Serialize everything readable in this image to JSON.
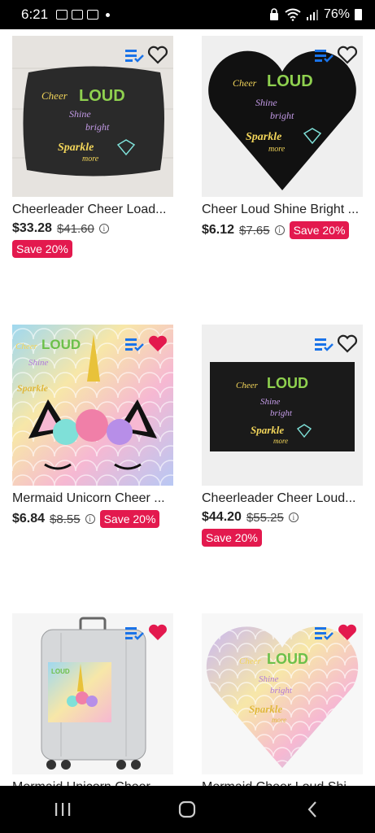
{
  "status_bar": {
    "time": "6:21",
    "battery": "76%"
  },
  "products": [
    {
      "title": "Cheerleader Cheer Load...",
      "price": "$33.28",
      "old_price": "$41.60",
      "badge": "Save 20%",
      "favorited": false
    },
    {
      "title": "Cheer Loud Shine Bright ...",
      "price": "$6.12",
      "old_price": "$7.65",
      "badge": "Save 20%",
      "favorited": false
    },
    {
      "title": "Mermaid Unicorn Cheer ...",
      "price": "$6.84",
      "old_price": "$8.55",
      "badge": "Save 20%",
      "favorited": true
    },
    {
      "title": "Cheerleader Cheer Loud...",
      "price": "$44.20",
      "old_price": "$55.25",
      "badge": "Save 20%",
      "favorited": false
    },
    {
      "title": "Mermaid Unicorn Cheer ...",
      "favorited": true
    },
    {
      "title": "Mermaid Cheer Loud Shi...",
      "favorited": true
    }
  ],
  "artwork": {
    "line1": "Cheer",
    "line2": "LOUD",
    "line3": "Shine",
    "line4": "bright",
    "line5": "Sparkle",
    "line6": "more"
  },
  "colors": {
    "sale_badge": "#e3194e",
    "heart_active": "#e3194e",
    "list_icon": "#1a73e8"
  }
}
